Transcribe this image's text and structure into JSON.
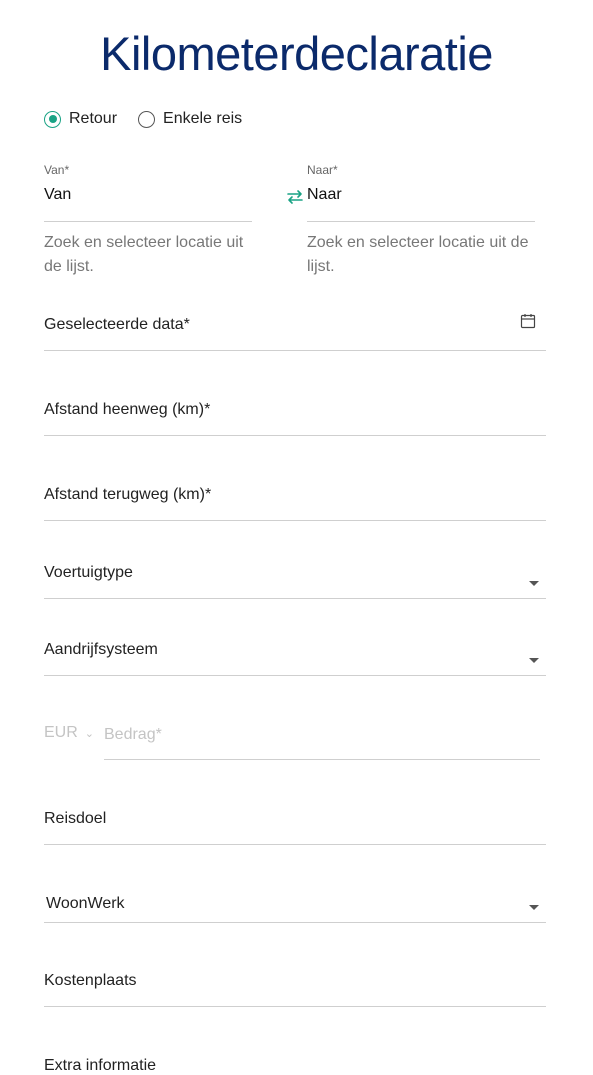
{
  "page": {
    "title": "Kilometerdeclaratie"
  },
  "trip_type": {
    "options": [
      {
        "label": "Retour",
        "checked": true
      },
      {
        "label": "Enkele reis",
        "checked": false
      }
    ]
  },
  "from": {
    "label": "Van*",
    "value": "Van",
    "helper": "Zoek en selecteer locatie uit de lijst."
  },
  "to": {
    "label": "Naar*",
    "value": "Naar",
    "helper": "Zoek en selecteer locatie uit de lijst."
  },
  "icons": {
    "swap": "swap-arrows-icon",
    "calendar": "calendar-icon",
    "dropdown": "caret-down-icon",
    "currency_chevron": "chevron-down-icon"
  },
  "colors": {
    "title": "#0b2a6b",
    "accent": "#1aa385",
    "placeholder": "#c4c4c4"
  },
  "fields": {
    "dates": {
      "label": "Geselecteerde data*"
    },
    "distance_out": {
      "label": "Afstand heenweg (km)*"
    },
    "distance_back": {
      "label": "Afstand terugweg (km)*"
    },
    "vehicle_type": {
      "label": "Voertuigtype"
    },
    "drive_system": {
      "label": "Aandrijfsysteem"
    },
    "currency": {
      "value": "EUR"
    },
    "amount": {
      "placeholder": "Bedrag*"
    },
    "purpose": {
      "label": "Reisdoel"
    },
    "purpose_select": {
      "value": "WoonWerk"
    },
    "cost_center": {
      "label": "Kostenplaats"
    },
    "extra_info": {
      "label": "Extra informatie"
    }
  }
}
